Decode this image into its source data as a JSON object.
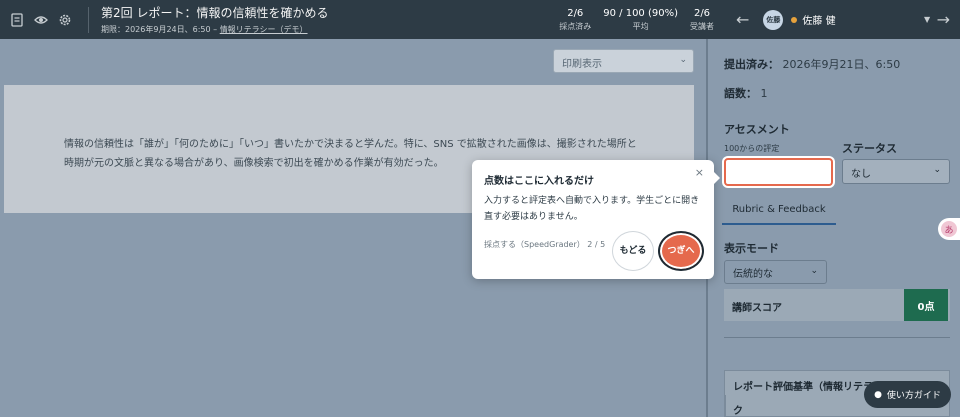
{
  "header": {
    "title": "第2回 レポート：情報の信頼性を確かめる",
    "deadline": "期限：2026年9月24日、6:50 –",
    "course_link": "情報リテラシー（デモ）",
    "stats": [
      {
        "value": "2/6",
        "label": "採点済み"
      },
      {
        "value": "90 / 100 (90%)",
        "label": "平均"
      },
      {
        "value": "2/6",
        "label": "受講者"
      }
    ],
    "avatar_text": "佐藤",
    "student_name": "佐藤 健"
  },
  "left": {
    "print_select": "印刷表示",
    "document_text": "情報の信頼性は「誰が」「何のために」「いつ」書いたかで決まると学んだ。特に、SNS で拡散された画像は、撮影された場所と時期が元の文脈と異なる場合があり、画像検索で初出を確かめる作業が有効だった。"
  },
  "right": {
    "submitted_label": "提出済み：",
    "submitted_value": "2026年9月21日、6:50",
    "word_count_label": "語数：",
    "word_count_value": "1",
    "assessment_heading": "アセスメント",
    "grade_sub": "100からの評定",
    "status_heading": "ステータス",
    "status_value": "なし",
    "tab_label": "Rubric & Feedback",
    "mode_heading": "表示モード",
    "mode_value": "伝統的な",
    "score_label": "講師スコア",
    "score_value": "0点",
    "rubric_heading": "レポート評価基準（情報リテラシー）",
    "rubric_row": "ク"
  },
  "popover": {
    "title": "点数はここに入れるだけ",
    "body": "入力すると評定表へ自動で入ります。学生ごとに開き直す必要はありません。",
    "step": "採点する（SpeedGrader） 2 / 5",
    "back_label": "もどる",
    "next_label": "つぎへ"
  },
  "guide_button": "使い方ガイド",
  "side_bubble": "あ"
}
